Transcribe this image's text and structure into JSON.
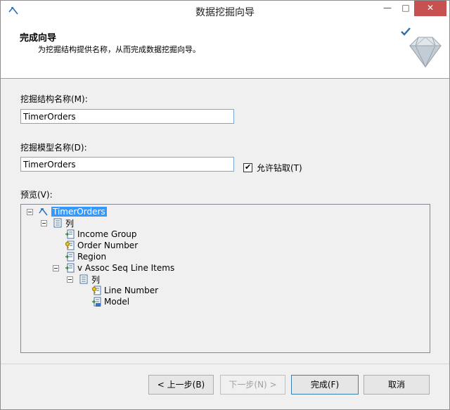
{
  "window": {
    "title": "数据挖掘向导"
  },
  "titlebar": {
    "minimize": "—",
    "maximize": "□",
    "close": "✕"
  },
  "header": {
    "title": "完成向导",
    "description": "为挖掘结构提供名称，从而完成数据挖掘向导。"
  },
  "form": {
    "structure_label": "挖掘结构名称(M):",
    "structure_value": "TimerOrders",
    "model_label": "挖掘模型名称(D):",
    "model_value": "TimerOrders",
    "drillthrough_label": "允许钻取(T)",
    "drillthrough_checked": true,
    "preview_label": "预览(V):"
  },
  "tree": {
    "root": "TimerOrders",
    "columns_1": "列",
    "income_group": "Income Group",
    "order_number": "Order Number",
    "region": "Region",
    "nested_table": "v Assoc Seq Line Items",
    "columns_2": "列",
    "line_number": "Line Number",
    "model": "Model"
  },
  "buttons": {
    "back": "< 上一步(B)",
    "next": "下一步(N) >",
    "finish": "完成(F)",
    "cancel": "取消"
  },
  "colors": {
    "selection": "#3399ff",
    "close_button": "#c75050",
    "textbox_border": "#7aa7d8"
  },
  "icons": [
    "app-icon",
    "diamond-icon",
    "check-icon",
    "structure-icon",
    "columns-icon",
    "column-input-icon",
    "key-column-icon",
    "nested-table-icon",
    "predict-column-icon"
  ]
}
